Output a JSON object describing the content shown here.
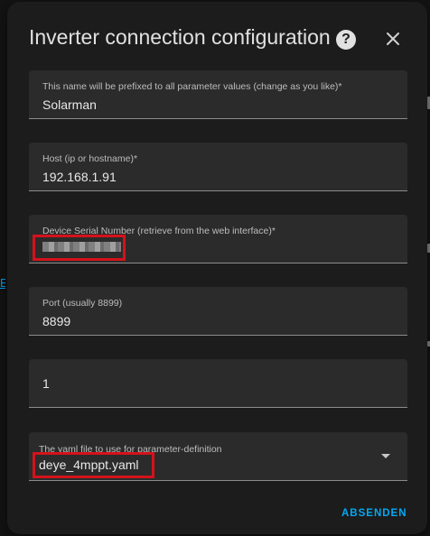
{
  "dialog": {
    "title": "Inverter connection configuration",
    "help_icon": "?",
    "close_icon": "close-icon"
  },
  "fields": [
    {
      "label": "This name will be prefixed to all parameter values (change as you like)*",
      "value": "Solarman"
    },
    {
      "label": "Host (ip or hostname)*",
      "value": "192.168.1.91"
    },
    {
      "label": "Device Serial Number (retrieve from the web interface)*",
      "value": ""
    },
    {
      "label": "Port (usually 8899)",
      "value": "8899"
    },
    {
      "label": "",
      "value": "1"
    },
    {
      "label": "The yaml file to use for parameter-definition",
      "value": "deye_4mppt.yaml"
    }
  ],
  "actions": {
    "submit_label": "ABSENDEN"
  },
  "colors": {
    "accent": "#03a9f4",
    "highlight": "#d4121b",
    "dialog_bg": "#1c1c1c",
    "field_bg": "#2b2b2b"
  }
}
